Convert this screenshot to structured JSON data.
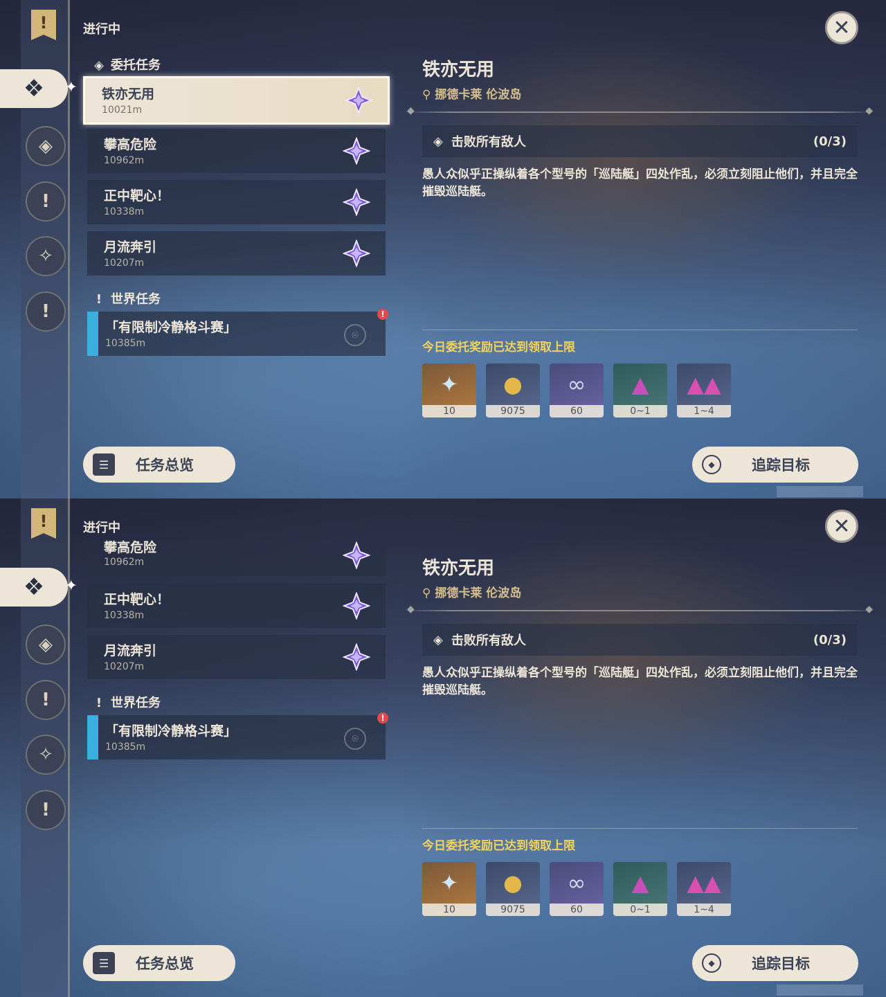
{
  "screens": [
    {
      "section_progress": "进行中",
      "commission_header": "委托任务",
      "commission_quests": [
        {
          "name": "铁亦无用",
          "distance": "10021m",
          "selected": true
        },
        {
          "name": "攀高危险",
          "distance": "10962m"
        },
        {
          "name": "正中靶心！",
          "distance": "10338m"
        },
        {
          "name": "月流奔引",
          "distance": "10207m"
        }
      ],
      "world_header": "世界任务",
      "world_quests": [
        {
          "name": "「有限制冷静格斗赛」",
          "distance": "10385m",
          "alert": "!"
        }
      ],
      "overview_label": "任务总览",
      "detail": {
        "title": "铁亦无用",
        "location": "挪德卡莱 伦波岛",
        "objective": "击败所有敌人",
        "objective_count": "(0/3)",
        "description": "愚人众似乎正操纵着各个型号的「巡陆艇」四处作乱，必须立刻阻止他们，并且完全摧毁巡陆艇。",
        "reward_title": "今日委托奖励已达到领取上限",
        "rewards": [
          {
            "icon": "primogem-icon",
            "qty": "10"
          },
          {
            "icon": "mora-icon",
            "qty": "9075"
          },
          {
            "icon": "companionship-exp-icon",
            "qty": "60"
          },
          {
            "icon": "ore-crystal-icon",
            "qty": "0~1"
          },
          {
            "icon": "crystal-cluster-icon",
            "qty": "1~4"
          }
        ],
        "track_label": "追踪目标"
      }
    },
    {
      "section_progress": "进行中",
      "commission_quests": [
        {
          "name": "攀高危险",
          "distance": "10962m"
        },
        {
          "name": "正中靶心！",
          "distance": "10338m"
        },
        {
          "name": "月流奔引",
          "distance": "10207m"
        }
      ],
      "world_header": "世界任务",
      "world_quests": [
        {
          "name": "「有限制冷静格斗赛」",
          "distance": "10385m",
          "alert": "!"
        }
      ],
      "overview_label": "任务总览",
      "detail": {
        "title": "铁亦无用",
        "location": "挪德卡莱 伦波岛",
        "objective": "击败所有敌人",
        "objective_count": "(0/3)",
        "description": "愚人众似乎正操纵着各个型号的「巡陆艇」四处作乱，必须立刻阻止他们，并且完全摧毁巡陆艇。",
        "reward_title": "今日委托奖励已达到领取上限",
        "rewards": [
          {
            "icon": "primogem-icon",
            "qty": "10"
          },
          {
            "icon": "mora-icon",
            "qty": "9075"
          },
          {
            "icon": "companionship-exp-icon",
            "qty": "60"
          },
          {
            "icon": "ore-crystal-icon",
            "qty": "0~1"
          },
          {
            "icon": "crystal-cluster-icon",
            "qty": "1~4"
          }
        ],
        "track_label": "追踪目标"
      }
    }
  ],
  "colors": {
    "accent_gold": "#f3d35a",
    "panel_cream": "#ece5d8",
    "world_quest_bar": "#3ab0e0"
  }
}
